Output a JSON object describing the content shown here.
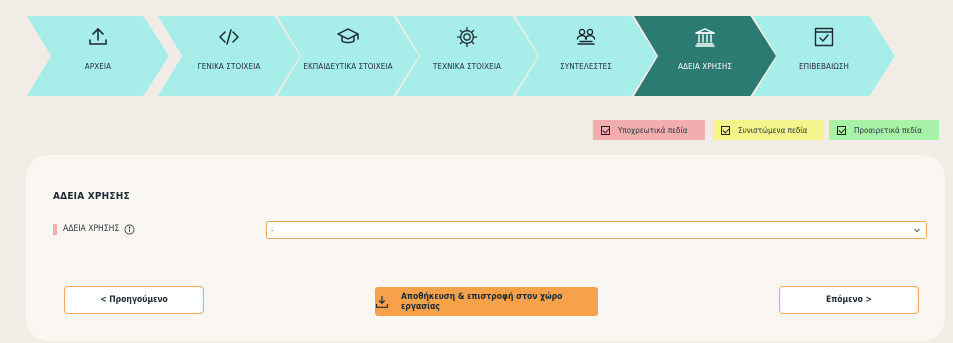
{
  "wizard": {
    "steps": [
      {
        "label": "ΑΡΧΕΙΑ",
        "icon": "upload-icon",
        "active": false
      },
      {
        "label": "ΓΕΝΙΚΑ ΣΤΟΙΧΕΙΑ",
        "icon": "code-icon",
        "active": false
      },
      {
        "label": "ΕΚΠΑΙΔΕΥΤΙΚΑ ΣΤΟΙΧΕΙΑ",
        "icon": "graduation-cap-icon",
        "active": false
      },
      {
        "label": "ΤΕΧΝΙΚΑ ΣΤΟΙΧΕΙΑ",
        "icon": "gear-icon",
        "active": false
      },
      {
        "label": "ΣΥΝΤΕΛΕΣΤΕΣ",
        "icon": "users-icon",
        "active": false
      },
      {
        "label": "ΑΔΕΙΑ ΧΡΗΣΗΣ",
        "icon": "institution-icon",
        "active": true
      },
      {
        "label": "ΕΠΙΒΕΒΑΙΩΣΗ",
        "icon": "check-square-icon",
        "active": false
      }
    ]
  },
  "legend": {
    "required": "Υποχρεωτικά πεδία",
    "recommended": "Συνιστώμενα πεδία",
    "optional": "Προαιρετικά πεδία"
  },
  "form": {
    "section_title": "ΑΔΕΙΑ ΧΡΗΣΗΣ",
    "license_label": "ΑΔΕΙΑ ΧΡΗΣΗΣ",
    "license_value": "-"
  },
  "buttons": {
    "prev": "< Προηγούμενο",
    "save": "Αποθήκευση & επιστροφή στον χώρο εργασίας",
    "next": "Επόμενο >"
  },
  "colors": {
    "step_bg": "#a7eeeb",
    "step_active": "#2b7b72",
    "accent_orange": "#f7a24b",
    "required": "#f2aeae",
    "recommended": "#f6f58c",
    "optional": "#a8f2a8"
  }
}
